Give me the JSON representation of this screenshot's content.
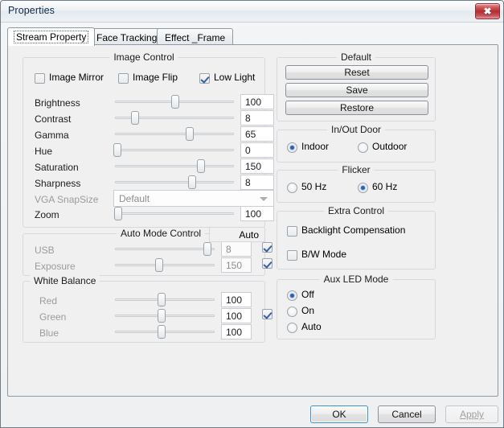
{
  "window": {
    "title": "Properties",
    "close_icon": "close-icon",
    "close_glyph": "✖"
  },
  "tabs": [
    {
      "label": "Stream Property",
      "selected": true
    },
    {
      "label": "Face Tracking",
      "selected": false
    },
    {
      "label": "Effect _Frame",
      "selected": false
    }
  ],
  "image_control": {
    "group_label": "Image Control",
    "checkboxes": [
      {
        "label": "Image Mirror",
        "checked": false
      },
      {
        "label": "Image Flip",
        "checked": false
      },
      {
        "label": "Low Light",
        "checked": true
      }
    ],
    "sliders": [
      {
        "label": "Brightness",
        "value": "100",
        "pct": 51,
        "enabled": true
      },
      {
        "label": "Contrast",
        "value": "8",
        "pct": 17,
        "enabled": true
      },
      {
        "label": "Gamma",
        "value": "65",
        "pct": 63,
        "enabled": true
      },
      {
        "label": "Hue",
        "value": "0",
        "pct": 2,
        "enabled": true
      },
      {
        "label": "Saturation",
        "value": "150",
        "pct": 72,
        "enabled": true
      },
      {
        "label": "Sharpness",
        "value": "8",
        "pct": 65,
        "enabled": true
      }
    ],
    "snapsize": {
      "label": "VGA SnapSize",
      "value": "Default",
      "enabled": false,
      "arrow_icon": "chevron-down-icon"
    },
    "zoom": {
      "label": "Zoom",
      "value": "100",
      "pct": 3,
      "enabled": true
    }
  },
  "auto_mode": {
    "group_label": "Auto Mode Control",
    "auto_header": "Auto",
    "rows": [
      {
        "label": "USB",
        "value": "8",
        "pct": 93,
        "auto": true,
        "enabled": false
      },
      {
        "label": "Exposure",
        "value": "150",
        "pct": 44,
        "auto": true,
        "enabled": false
      }
    ]
  },
  "white_balance": {
    "group_label": "White Balance",
    "auto_checked": true,
    "rows": [
      {
        "label": "Red",
        "value": "100",
        "pct": 47
      },
      {
        "label": "Green",
        "value": "100",
        "pct": 47
      },
      {
        "label": "Blue",
        "value": "100",
        "pct": 47
      }
    ]
  },
  "default_group": {
    "group_label": "Default",
    "buttons": [
      {
        "label": "Reset"
      },
      {
        "label": "Save"
      },
      {
        "label": "Restore"
      }
    ]
  },
  "in_out_door": {
    "group_label": "In/Out Door",
    "options": [
      {
        "label": "Indoor",
        "checked": true
      },
      {
        "label": "Outdoor",
        "checked": false
      }
    ]
  },
  "flicker": {
    "group_label": "Flicker",
    "options": [
      {
        "label": "50 Hz",
        "checked": false
      },
      {
        "label": "60 Hz",
        "checked": true
      }
    ]
  },
  "extra_control": {
    "group_label": "Extra Control",
    "checkboxes": [
      {
        "label": "Backlight Compensation",
        "checked": false
      },
      {
        "label": "B/W Mode",
        "checked": false
      }
    ]
  },
  "aux_led": {
    "group_label": "Aux LED Mode",
    "options": [
      {
        "label": "Off",
        "checked": true
      },
      {
        "label": "On",
        "checked": false
      },
      {
        "label": "Auto",
        "checked": false
      }
    ]
  },
  "footer": {
    "ok": "OK",
    "cancel": "Cancel",
    "apply": "Apply",
    "apply_enabled": false
  },
  "colors": {
    "accent_blue": "#2a63b5",
    "default_button_border": "#3c93d4",
    "close_red": "#b52b32",
    "dialog_bg": "#f0f0f0"
  }
}
